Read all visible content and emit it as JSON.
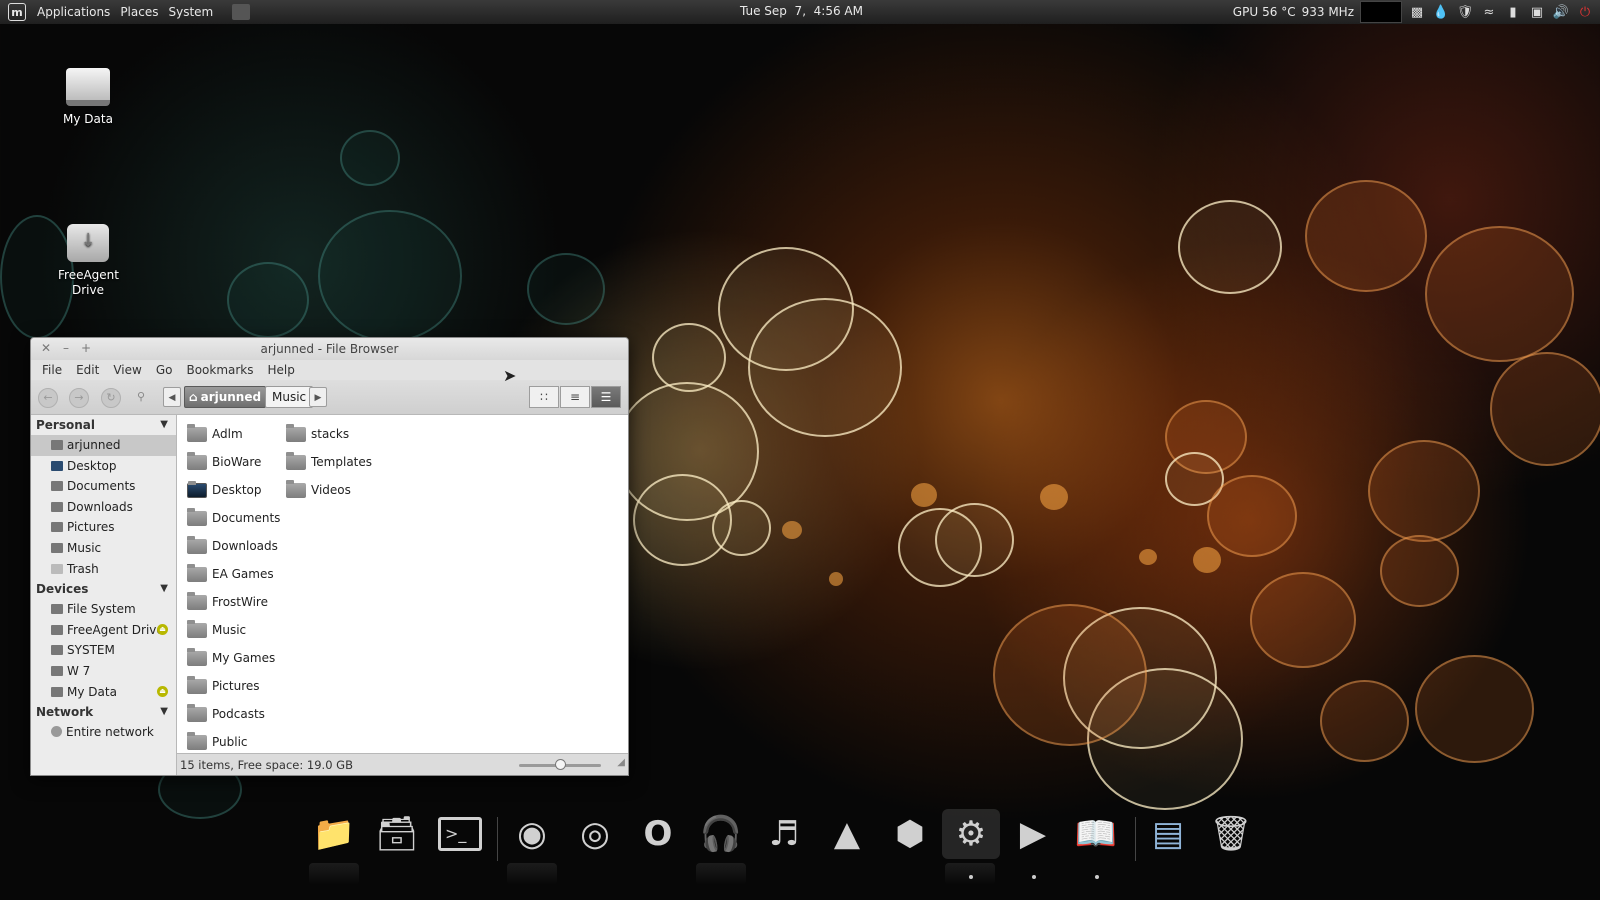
{
  "top_panel": {
    "menus": [
      "Applications",
      "Places",
      "System"
    ],
    "clock": "Tue Sep  7,  4:56 AM",
    "gpu_label": "GPU",
    "gpu_temp": "56 °C",
    "gpu_freq": "933 MHz",
    "tray_icons": [
      "screen-icon",
      "drop-icon",
      "shield-icon",
      "wifi-icon",
      "battery-icon",
      "network-icon",
      "volume-icon",
      "power-icon"
    ]
  },
  "desktop": {
    "icons": [
      {
        "label": "My Data"
      },
      {
        "label": "FreeAgent Drive"
      }
    ]
  },
  "window": {
    "title": "arjunned - File Browser",
    "menu": [
      "File",
      "Edit",
      "View",
      "Go",
      "Bookmarks",
      "Help"
    ],
    "breadcrumb": {
      "home": "arjunned",
      "current": "Music"
    },
    "sidebar": {
      "personal_header": "Personal",
      "personal": [
        "arjunned",
        "Desktop",
        "Documents",
        "Downloads",
        "Pictures",
        "Music",
        "Trash"
      ],
      "devices_header": "Devices",
      "devices": [
        "File System",
        "FreeAgent Drive",
        "SYSTEM",
        "W 7",
        "My Data"
      ],
      "network_header": "Network",
      "network": [
        "Entire network"
      ]
    },
    "files": [
      "Adlm",
      "BioWare",
      "Desktop",
      "Documents",
      "Downloads",
      "EA Games",
      "FrostWire",
      "Music",
      "My Games",
      "Pictures",
      "Podcasts",
      "Public",
      "stacks",
      "Templates",
      "Videos"
    ],
    "status": "15 items, Free space: 19.0 GB",
    "zoom_level": 0.5
  },
  "dock": {
    "items": [
      "files-icon",
      "file-manager-icon",
      "terminal-icon",
      "firefox-icon",
      "chrome-icon",
      "opera-icon",
      "headphones-icon",
      "music-player-icon",
      "drop-icon",
      "package-icon",
      "settings-icon",
      "media-player-icon",
      "document-viewer-icon",
      "installer-icon",
      "trash-icon"
    ]
  }
}
